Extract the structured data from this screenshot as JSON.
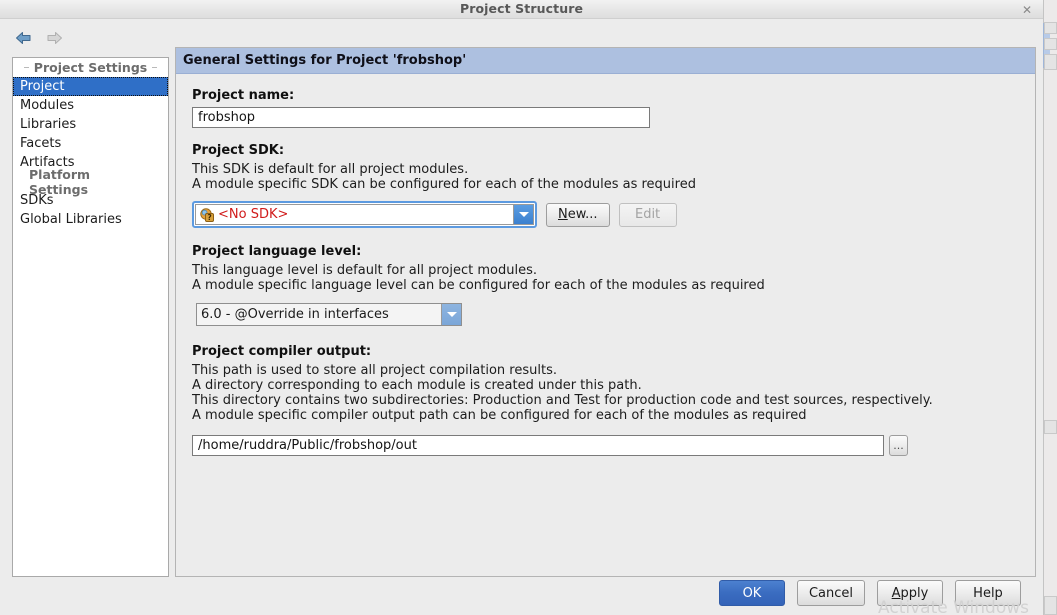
{
  "window": {
    "title": "Project Structure",
    "close_label": "✕"
  },
  "nav": {
    "back_name": "back-arrow",
    "forward_name": "forward-arrow"
  },
  "sidebar": {
    "groups": [
      {
        "header": "Project Settings",
        "items": [
          {
            "label": "Project",
            "selected": true
          },
          {
            "label": "Modules",
            "selected": false
          },
          {
            "label": "Libraries",
            "selected": false
          },
          {
            "label": "Facets",
            "selected": false
          },
          {
            "label": "Artifacts",
            "selected": false
          }
        ]
      },
      {
        "header": "Platform Settings",
        "items": [
          {
            "label": "SDKs",
            "selected": false
          },
          {
            "label": "Global Libraries",
            "selected": false
          }
        ]
      }
    ]
  },
  "panel": {
    "header": "General Settings for Project 'frobshop'",
    "project_name": {
      "title": "Project name:",
      "value": "frobshop",
      "placeholder": ""
    },
    "project_sdk": {
      "title": "Project SDK:",
      "desc": [
        "This SDK is default for all project modules.",
        "A module specific SDK can be configured for each of the modules as required"
      ],
      "value": "<No SDK>",
      "icon": "sdk-unknown-icon",
      "value_color": "#d01b1b",
      "new_button": "New...",
      "new_button_mnemonic": "N",
      "edit_button": "Edit",
      "edit_disabled": true
    },
    "language_level": {
      "title": "Project language level:",
      "desc": [
        "This language level is default for all project modules.",
        "A module specific language level can be configured for each of the modules as required"
      ],
      "value": "6.0 - @Override in interfaces"
    },
    "compiler_output": {
      "title": "Project compiler output:",
      "desc": [
        "This path is used to store all project compilation results.",
        "A directory corresponding to each module is created under this path.",
        "This directory contains two subdirectories: Production and Test for production code and test sources, respectively.",
        "A module specific compiler output path can be configured for each of the modules as required"
      ],
      "value": "/home/ruddra/Public/frobshop/out",
      "browse_label": "..."
    }
  },
  "footer": {
    "ok": "OK",
    "cancel": "Cancel",
    "apply": "Apply",
    "apply_mnemonic": "A",
    "help": "Help"
  },
  "watermark": {
    "text": "Activate Windows"
  },
  "colors": {
    "accent_blue": "#3b6fc4",
    "panel_header": "#adc0e0",
    "selection": "#2f6fc7",
    "error_red": "#d01b1b"
  }
}
